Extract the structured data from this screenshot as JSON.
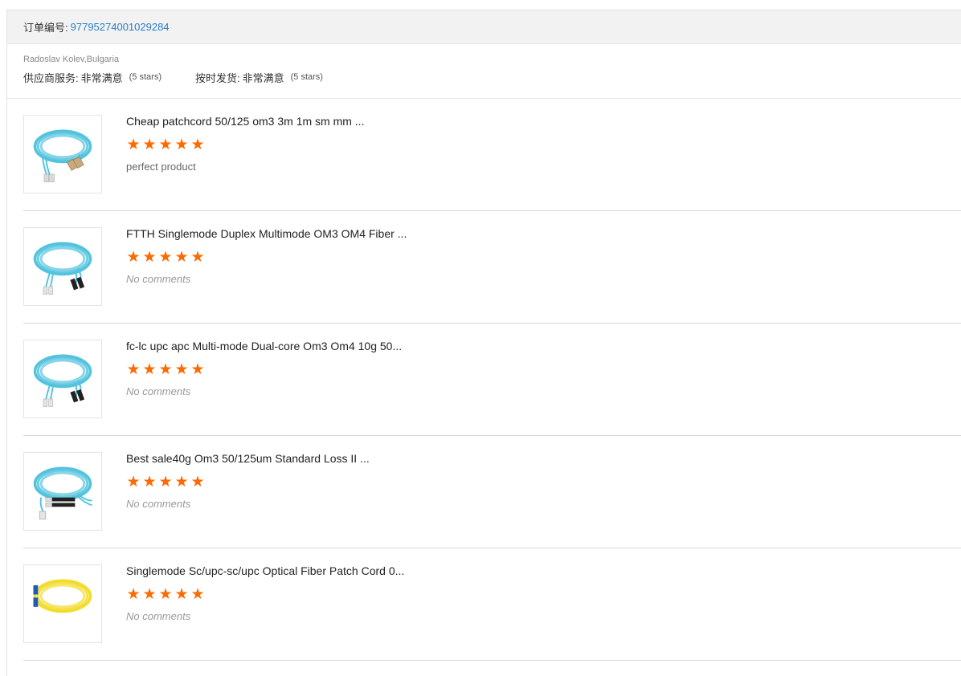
{
  "order": {
    "label": "订单编号:",
    "number": "97795274001029284"
  },
  "buyer": {
    "name": "Radoslav Kolev,Bulgaria",
    "ratings": [
      {
        "label": "供应商服务:",
        "value": "非常满意",
        "note": "(5 stars)"
      },
      {
        "label": "按时发货:",
        "value": "非常满意",
        "note": "(5 stars)"
      }
    ]
  },
  "star_glyph": "★",
  "colors": {
    "star": "#ff6a00",
    "link": "#2a7fc8",
    "aqua_cable": "#52c3dd",
    "yellow_cable": "#f2dc2a",
    "blue_connector": "#2159b8"
  },
  "products": [
    {
      "title": "Cheap patchcord 50/125 om3 3m 1m sm mm ...",
      "stars": 5,
      "comment": "perfect product",
      "has_comment": true,
      "thumb_icon": "aqua-fiber-cable-sc-icon"
    },
    {
      "title": "FTTH Singlemode Duplex Multimode OM3 OM4 Fiber ...",
      "stars": 5,
      "comment": "No comments",
      "has_comment": false,
      "thumb_icon": "aqua-fiber-cable-lc-fc-icon"
    },
    {
      "title": "fc-lc upc apc Multi-mode Dual-core Om3 Om4 10g 50...",
      "stars": 5,
      "comment": "No comments",
      "has_comment": false,
      "thumb_icon": "aqua-fiber-cable-lc-fc-icon"
    },
    {
      "title": "Best sale40g Om3 50/125um Standard Loss II ...",
      "stars": 5,
      "comment": "No comments",
      "has_comment": false,
      "thumb_icon": "aqua-fiber-cable-st-icon"
    },
    {
      "title": "Singlemode Sc/upc-sc/upc Optical Fiber Patch Cord 0...",
      "stars": 5,
      "comment": "No comments",
      "has_comment": false,
      "thumb_icon": "yellow-fiber-cable-sc-icon"
    }
  ]
}
